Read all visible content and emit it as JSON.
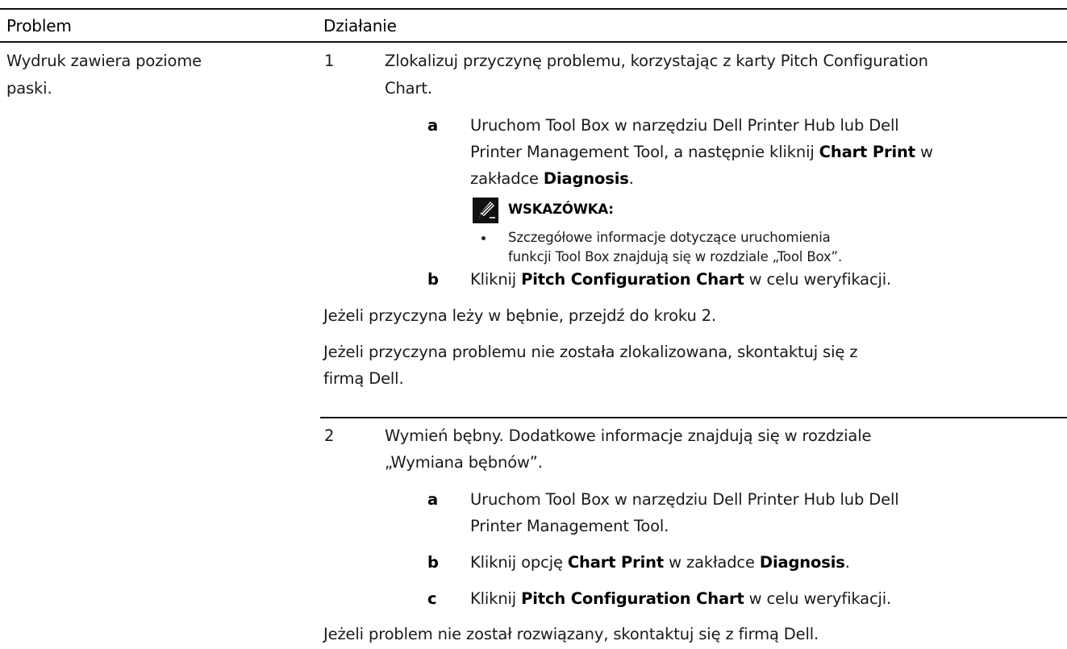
{
  "table": {
    "header": {
      "problem": "Problem",
      "action": "Działanie"
    },
    "problem": {
      "line1": "Wydruk zawiera poziome",
      "line2": "paski."
    },
    "step1": {
      "num": "1",
      "line1": "Zlokalizuj przyczynę problemu, korzystając z karty Pitch Configuration",
      "line2": "Chart.",
      "a": {
        "label": "a",
        "line1": "Uruchom Tool Box w narzędziu Dell Printer Hub lub Dell",
        "line2_pre": "Printer Management Tool, a następnie kliknij ",
        "line2_bold": "Chart Print",
        "line2_post": " w",
        "line3_pre": "zakładce ",
        "line3_bold": "Diagnosis",
        "line3_post": "."
      },
      "note": {
        "icon": "pencil-note-icon",
        "title": "WSKAZÓWKA:",
        "bullet_line1": "Szczegółowe informacje dotyczące uruchomienia",
        "bullet_line2": "funkcji Tool Box znajdują się w rozdziale „Tool Box”."
      },
      "b": {
        "label": "b",
        "pre": "Kliknij ",
        "bold": "Pitch Configuration Chart",
        "post": " w celu weryfikacji."
      },
      "result1": "Jeżeli przyczyna leży w bębnie, przejdź do kroku 2.",
      "result2_line1": "Jeżeli przyczyna problemu nie została zlokalizowana, skontaktuj się z",
      "result2_line2": "firmą Dell."
    },
    "step2": {
      "num": "2",
      "line1": "Wymień bębny. Dodatkowe informacje znajdują się w rozdziale",
      "line2": "„Wymiana bębnów”.",
      "a": {
        "label": "a",
        "line1": "Uruchom Tool Box w narzędziu Dell Printer Hub lub Dell",
        "line2": "Printer Management Tool."
      },
      "b": {
        "label": "b",
        "pre": "Kliknij opcję ",
        "bold1": "Chart Print",
        "mid": " w zakładce ",
        "bold2": "Diagnosis",
        "post": "."
      },
      "c": {
        "label": "c",
        "pre": "Kliknij ",
        "bold": "Pitch Configuration Chart",
        "post": " w celu weryfikacji."
      },
      "result": "Jeżeli problem nie został rozwiązany, skontaktuj się z firmą Dell."
    }
  }
}
